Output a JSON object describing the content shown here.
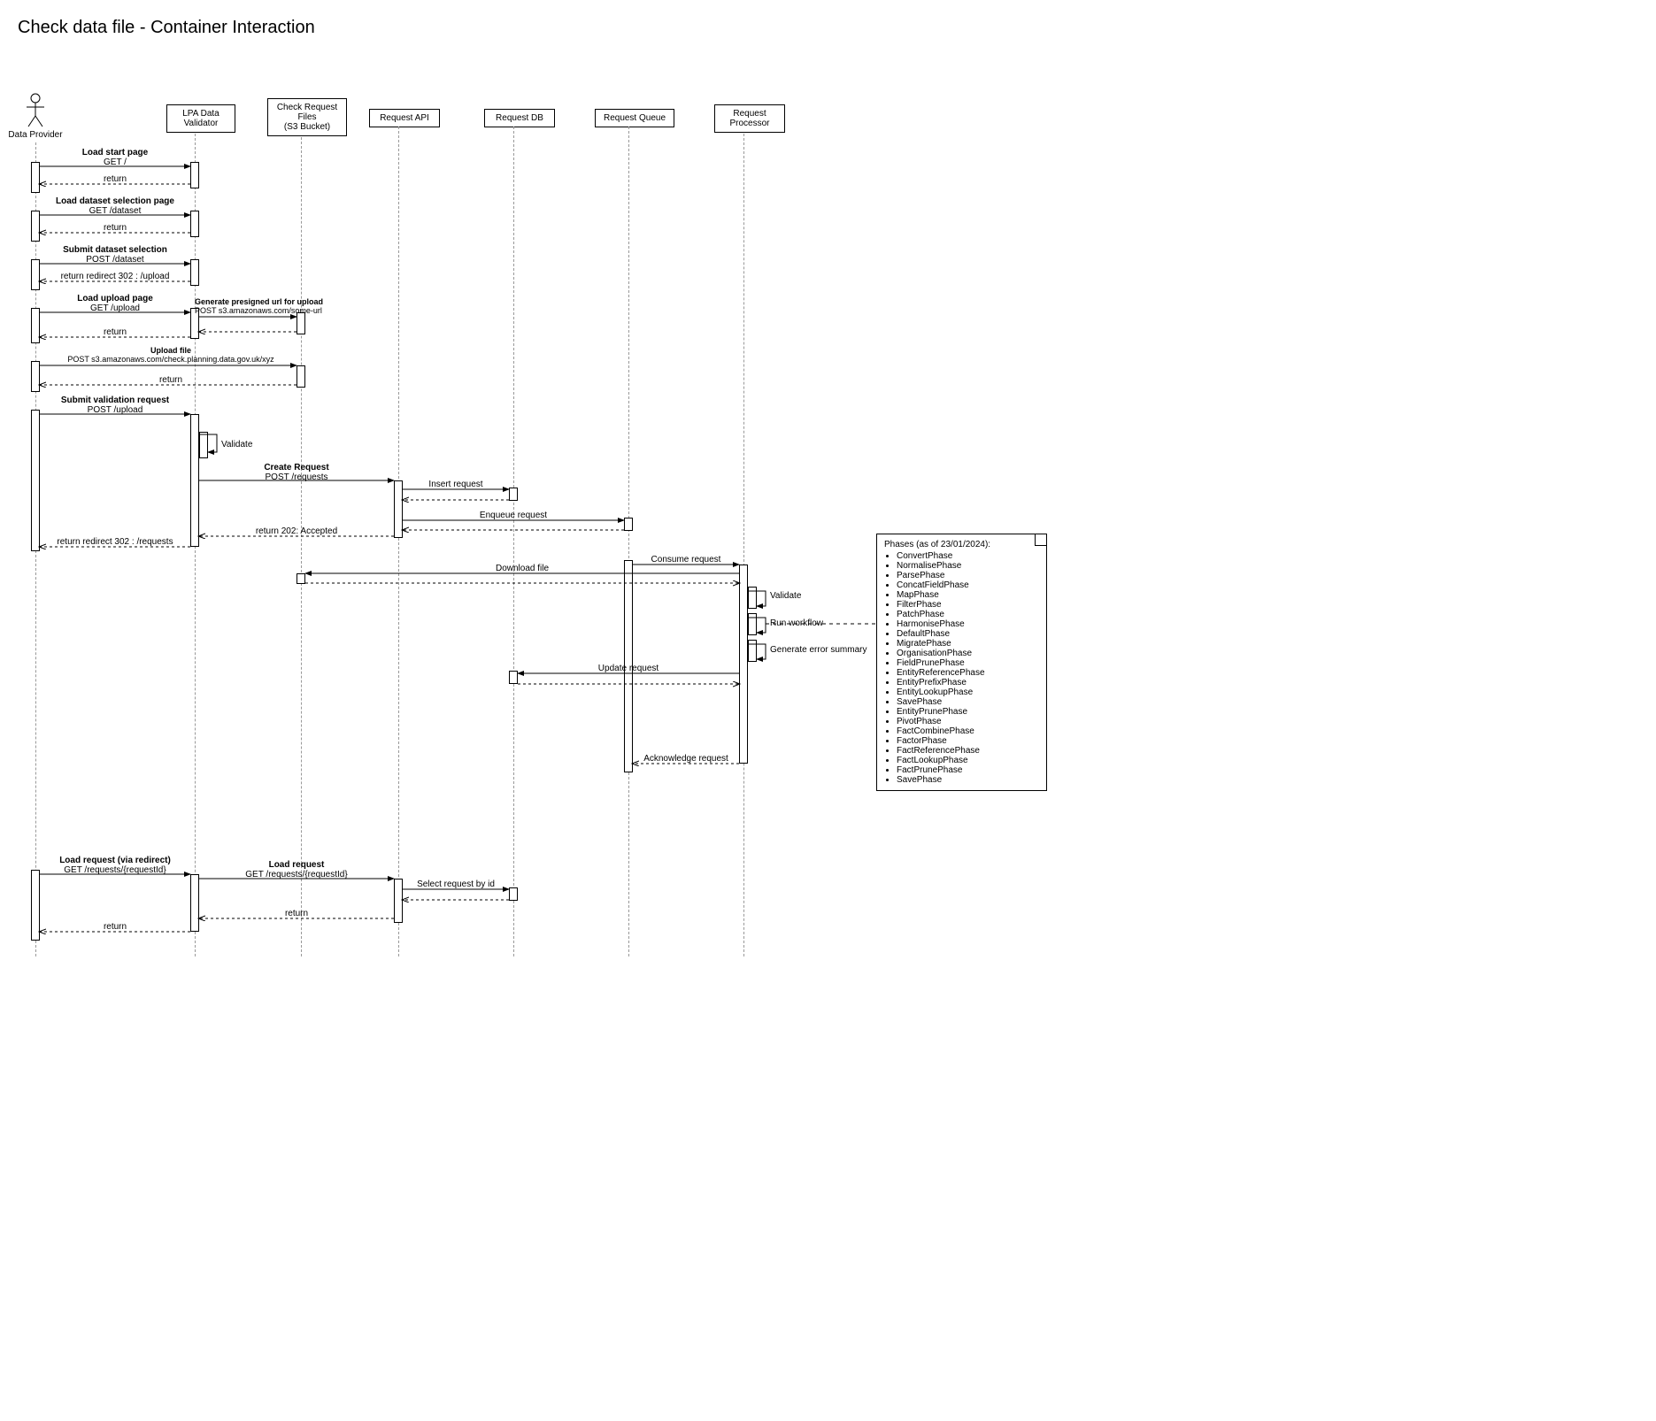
{
  "title": "Check data file - Container Interaction",
  "participants": {
    "data_provider": "Data Provider",
    "lpa_validator": "LPA Data\nValidator",
    "s3_bucket": "Check Request\nFiles\n(S3 Bucket)",
    "request_api": "Request API",
    "request_db": "Request DB",
    "request_queue": "Request Queue",
    "request_processor": "Request\nProcessor"
  },
  "messages": {
    "load_start": {
      "title": "Load start page",
      "sub": "GET /"
    },
    "return1": "return",
    "load_dataset": {
      "title": "Load dataset selection page",
      "sub": "GET /dataset"
    },
    "return2": "return",
    "submit_dataset": {
      "title": "Submit dataset selection",
      "sub": "POST /dataset"
    },
    "return_redirect_upload": "return redirect 302 : /upload",
    "load_upload": {
      "title": "Load upload page",
      "sub": "GET /upload"
    },
    "gen_presigned": {
      "title": "Generate presigned url for upload",
      "sub": "POST s3.amazonaws.com/some-url"
    },
    "return3": "return",
    "upload_file": {
      "title": "Upload file",
      "sub": "POST s3.amazonaws.com/check.planning.data.gov.uk/xyz"
    },
    "return4": "return",
    "submit_validation": {
      "title": "Submit validation request",
      "sub": "POST /upload"
    },
    "validate_self": "Validate",
    "create_request": {
      "title": "Create Request",
      "sub": "POST /requests"
    },
    "insert_request": "Insert request",
    "enqueue_request": "Enqueue request",
    "return_accepted": "return 202: Accepted",
    "return_redirect_requests": "return redirect 302 : /requests",
    "consume_request": "Consume request",
    "download_file": "Download file",
    "validate_self2": "Validate",
    "run_workflow": "Run workflow",
    "gen_error_summary": "Generate error summary",
    "update_request": "Update request",
    "ack_request": "Acknowledge request",
    "load_request_redirect": {
      "title": "Load request (via redirect)",
      "sub": "GET /requests/{requestId}"
    },
    "load_request": {
      "title": "Load request",
      "sub": "GET /requests/{requestId}"
    },
    "select_by_id": "Select request by id",
    "return5": "return",
    "return6": "return"
  },
  "note": {
    "heading": "Phases (as of 23/01/2024):",
    "items": [
      "ConvertPhase",
      "NormalisePhase",
      "ParsePhase",
      "ConcatFieldPhase",
      "MapPhase",
      "FilterPhase",
      "PatchPhase",
      "HarmonisePhase",
      "DefaultPhase",
      "MigratePhase",
      "OrganisationPhase",
      "FieldPrunePhase",
      "EntityReferencePhase",
      "EntityPrefixPhase",
      "EntityLookupPhase",
      "SavePhase",
      "EntityPrunePhase",
      "PivotPhase",
      "FactCombinePhase",
      "FactorPhase",
      "FactReferencePhase",
      "FactLookupPhase",
      "FactPrunePhase",
      "SavePhase"
    ]
  }
}
